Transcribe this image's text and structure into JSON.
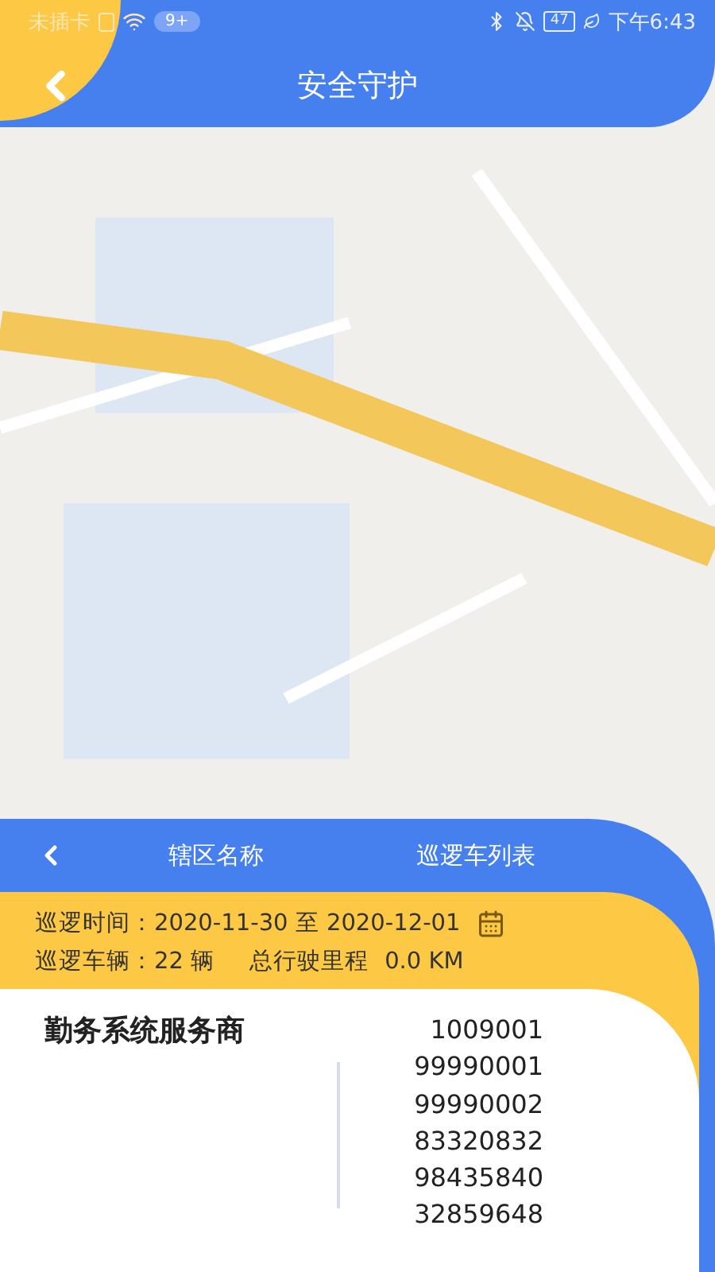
{
  "status_bar": {
    "carrier": "未插卡",
    "badge": "9+",
    "battery": "47",
    "time": "下午6:43"
  },
  "header": {
    "title": "安全守护"
  },
  "panel": {
    "district": "辖区名称",
    "vehicle_list": "巡逻车列表",
    "patrol_time": "巡逻时间：2020-11-30 至 2020-12-01",
    "vehicles": "巡逻车辆：22 辆",
    "mileage_label": "总行驶里程",
    "mileage": "0.0 KM"
  },
  "provider": {
    "title": "勤务系统服务商",
    "ids": [
      "1009001",
      "99990001",
      "99990002",
      "83320832",
      "98435840",
      "32859648"
    ]
  }
}
